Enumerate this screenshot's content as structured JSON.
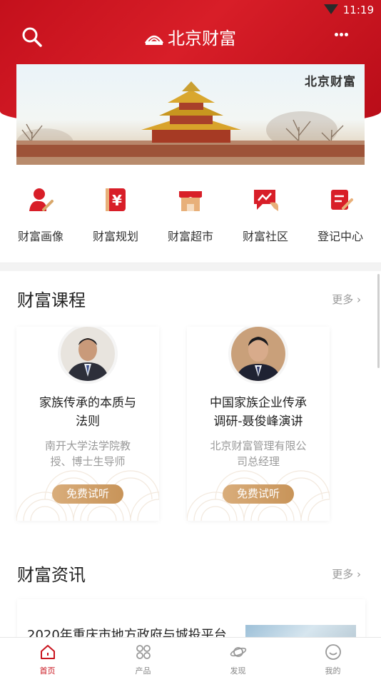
{
  "status_bar": {
    "time": "11:19"
  },
  "app_bar": {
    "title": "北京财富"
  },
  "banner": {
    "caption": "北京财富"
  },
  "quick_links": [
    {
      "label": "财富画像",
      "icon": "portrait-icon"
    },
    {
      "label": "财富规划",
      "icon": "yuan-icon"
    },
    {
      "label": "财富超市",
      "icon": "store-icon"
    },
    {
      "label": "财富社区",
      "icon": "chat-trend-icon"
    },
    {
      "label": "登记中心",
      "icon": "register-icon"
    }
  ],
  "courses": {
    "title": "财富课程",
    "more": "更多 ›",
    "items": [
      {
        "title_line1": "家族传承的本质与",
        "title_line2": "法则",
        "desc_line1": "南开大学法学院教",
        "desc_line2": "授、博士生导师",
        "button": "免费试听"
      },
      {
        "title_line1": "中国家族企业传承",
        "title_line2": "调研-聂俊峰演讲",
        "desc_line1": "北京财富管理有限公",
        "desc_line2": "司总经理",
        "button": "免费试听"
      }
    ]
  },
  "news": {
    "title": "财富资讯",
    "more": "更多 ›",
    "first_item_title": "2020年重庆市地方政府与城投平台"
  },
  "tab_bar": [
    {
      "label": "首页",
      "icon": "home-icon",
      "active": true
    },
    {
      "label": "产品",
      "icon": "grid-icon",
      "active": false
    },
    {
      "label": "发现",
      "icon": "planet-icon",
      "active": false
    },
    {
      "label": "我的",
      "icon": "profile-icon",
      "active": false
    }
  ],
  "colors": {
    "brand_red": "#c9141e",
    "button_gold": "#d1a06a"
  }
}
